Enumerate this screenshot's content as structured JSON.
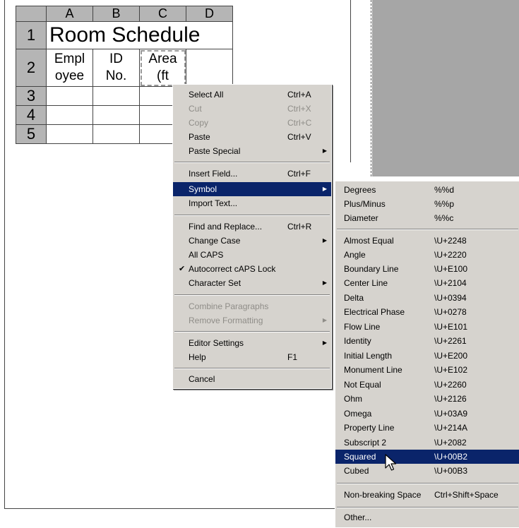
{
  "table": {
    "col_headers": [
      "A",
      "B",
      "C",
      "D"
    ],
    "row_headers": [
      "1",
      "2",
      "3",
      "4",
      "5"
    ],
    "title": "Room Schedule",
    "col_a_line1": "Empl",
    "col_a_line2": "oyee",
    "col_b_line1": "ID",
    "col_b_line2": "No.",
    "col_c_line1": "Area",
    "col_c_line2": "(ft"
  },
  "context_menu": {
    "select_all": {
      "label": "Select All",
      "shortcut": "Ctrl+A"
    },
    "cut": {
      "label": "Cut",
      "shortcut": "Ctrl+X"
    },
    "copy": {
      "label": "Copy",
      "shortcut": "Ctrl+C"
    },
    "paste": {
      "label": "Paste",
      "shortcut": "Ctrl+V"
    },
    "paste_special": {
      "label": "Paste Special"
    },
    "insert_field": {
      "label": "Insert Field...",
      "shortcut": "Ctrl+F"
    },
    "symbol": {
      "label": "Symbol"
    },
    "import_text": {
      "label": "Import Text..."
    },
    "find_replace": {
      "label": "Find and Replace...",
      "shortcut": "Ctrl+R"
    },
    "change_case": {
      "label": "Change Case"
    },
    "all_caps": {
      "label": "All CAPS"
    },
    "autocorrect": {
      "label": "Autocorrect cAPS Lock"
    },
    "character_set": {
      "label": "Character Set"
    },
    "combine_paragraphs": {
      "label": "Combine Paragraphs"
    },
    "remove_formatting": {
      "label": "Remove Formatting"
    },
    "editor_settings": {
      "label": "Editor Settings"
    },
    "help": {
      "label": "Help",
      "shortcut": "F1"
    },
    "cancel": {
      "label": "Cancel"
    }
  },
  "symbol_menu": {
    "items": [
      {
        "label": "Degrees",
        "code": "%%d"
      },
      {
        "label": "Plus/Minus",
        "code": "%%p"
      },
      {
        "label": "Diameter",
        "code": "%%c"
      },
      {
        "label": "Almost Equal",
        "code": "\\U+2248"
      },
      {
        "label": "Angle",
        "code": "\\U+2220"
      },
      {
        "label": "Boundary Line",
        "code": "\\U+E100"
      },
      {
        "label": "Center Line",
        "code": "\\U+2104"
      },
      {
        "label": "Delta",
        "code": "\\U+0394"
      },
      {
        "label": "Electrical Phase",
        "code": "\\U+0278"
      },
      {
        "label": "Flow Line",
        "code": "\\U+E101"
      },
      {
        "label": "Identity",
        "code": "\\U+2261"
      },
      {
        "label": "Initial Length",
        "code": "\\U+E200"
      },
      {
        "label": "Monument Line",
        "code": "\\U+E102"
      },
      {
        "label": "Not Equal",
        "code": "\\U+2260"
      },
      {
        "label": "Ohm",
        "code": "\\U+2126"
      },
      {
        "label": "Omega",
        "code": "\\U+03A9"
      },
      {
        "label": "Property Line",
        "code": "\\U+214A"
      },
      {
        "label": "Subscript 2",
        "code": "\\U+2082"
      },
      {
        "label": "Squared",
        "code": "\\U+00B2"
      },
      {
        "label": "Cubed",
        "code": "\\U+00B3"
      },
      {
        "label": "Non-breaking Space",
        "code": "Ctrl+Shift+Space"
      },
      {
        "label": "Other...",
        "code": ""
      }
    ]
  },
  "colors": {
    "menu_bg": "#d6d3ce",
    "highlight": "#0a246a",
    "header_gray": "#b5b5b5",
    "canvas_gray": "#a6a6a6"
  },
  "icons": {
    "submenu_arrow": "triangle-right-icon",
    "check": "checkmark-icon",
    "cursor": "mouse-pointer-icon"
  }
}
